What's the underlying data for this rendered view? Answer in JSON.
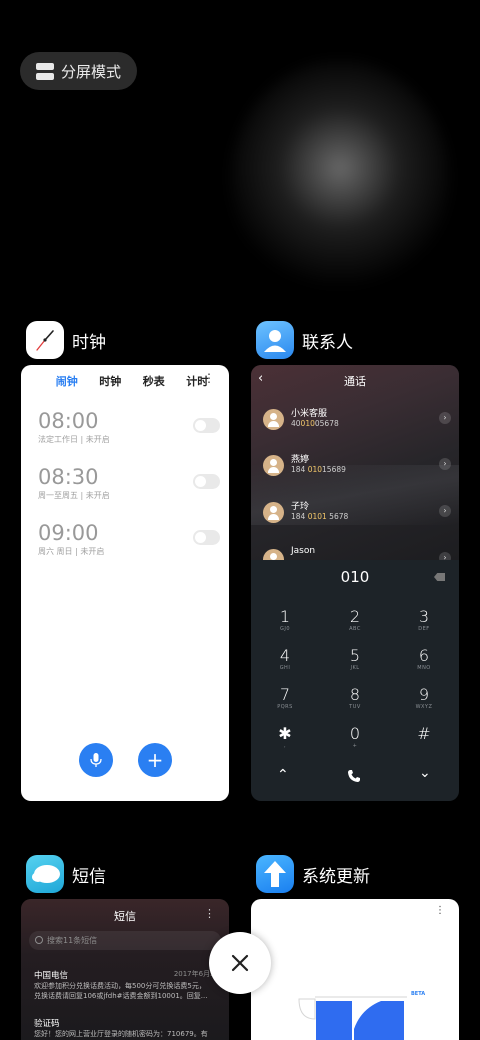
{
  "split_mode": {
    "label": "分屏模式"
  },
  "apps": {
    "clock": {
      "title": "时钟"
    },
    "contacts": {
      "title": "联系人"
    },
    "sms": {
      "title": "短信"
    },
    "update": {
      "title": "系统更新"
    }
  },
  "clock": {
    "tabs": [
      "闹钟",
      "时钟",
      "秒表",
      "计时"
    ],
    "active_tab": "闹钟",
    "more": "⋮",
    "alarms": [
      {
        "time": "08:00",
        "desc": "法定工作日 | 未开启",
        "enabled": false
      },
      {
        "time": "08:30",
        "desc": "周一至周五 | 未开启",
        "enabled": false
      },
      {
        "time": "09:00",
        "desc": "周六 周日 | 未开启",
        "enabled": false
      }
    ],
    "add": "+"
  },
  "contacts": {
    "back": "‹",
    "title": "通话",
    "list": [
      {
        "name": "小米客服",
        "num_pre": "40",
        "num_hl": "010",
        "num_post": "05678"
      },
      {
        "name": "燕婷",
        "num_pre": "184 ",
        "num_hl": "010",
        "num_post": "15689"
      },
      {
        "name": "子玲",
        "num_pre": "184 ",
        "num_hl": "0101",
        "num_post": " 5678"
      },
      {
        "name": "Jason",
        "num_pre": "",
        "num_hl": "",
        "num_post": ""
      }
    ],
    "dial_input": "010",
    "keys": [
      {
        "n": "1",
        "l": "GJ0"
      },
      {
        "n": "2",
        "l": "ABC"
      },
      {
        "n": "3",
        "l": "DEF"
      },
      {
        "n": "4",
        "l": "GHI"
      },
      {
        "n": "5",
        "l": "JKL"
      },
      {
        "n": "6",
        "l": "MNO"
      },
      {
        "n": "7",
        "l": "PQRS"
      },
      {
        "n": "8",
        "l": "TUV"
      },
      {
        "n": "9",
        "l": "WXYZ"
      },
      {
        "n": "✱",
        "l": ","
      },
      {
        "n": "0",
        "l": "+"
      },
      {
        "n": "#",
        "l": ""
      }
    ],
    "bottom": {
      "left": "⌃",
      "right": "⌄"
    }
  },
  "sms": {
    "title": "短信",
    "more": "⋮",
    "search_placeholder": "搜索11条短信",
    "messages": [
      {
        "sender": "中国电信",
        "date": "2017年6月30",
        "preview1": "欢迎参加积分兑换话费活动，每500分可兑换话费5元，",
        "preview2": "兑换话费请回复106或jfdh#话费金额到10001。回复..."
      },
      {
        "sender": "验证码",
        "date": "",
        "preview1": "您好！您的网上营业厅登录的随机密码为：710679。有",
        "preview2": ""
      }
    ]
  },
  "update": {
    "more": "⋮",
    "beta": "BETA"
  },
  "close": {
    "label": "✕"
  }
}
